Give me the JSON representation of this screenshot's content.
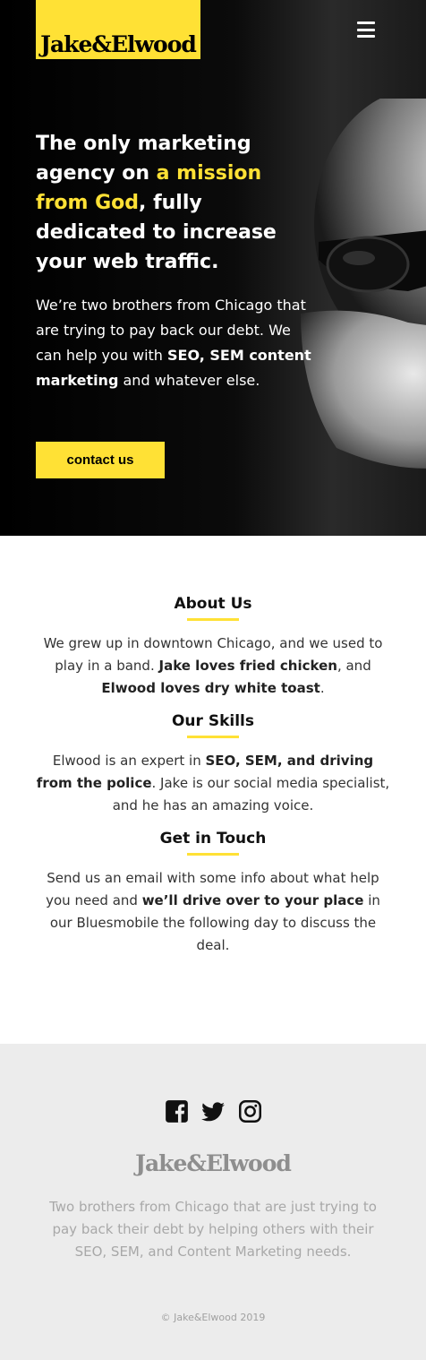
{
  "header": {
    "logo": "Jake&Elwood",
    "menu_icon": "hamburger-menu-icon"
  },
  "hero": {
    "title_part1": "The only marketing agency on ",
    "title_highlight": "a mission from God",
    "title_part2": ", fully dedicated to increase your web traffic.",
    "text_part1": "We’re two brothers from Chicago that are trying to pay back our debt. We can help you with ",
    "text_bold": "SEO, SEM content marketing",
    "text_part2": " and whatever else.",
    "cta_label": "contact us"
  },
  "sections": {
    "about": {
      "title": "About Us",
      "p1": "We grew up in downtown Chicago, and we used to play in a band. ",
      "b1": "Jake loves fried chicken",
      "p2": ", and ",
      "b2": "Elwood loves dry white toast",
      "p3": "."
    },
    "skills": {
      "title": "Our Skills",
      "p1": "Elwood is an expert in ",
      "b1": "SEO, SEM, and driving from the police",
      "p2": ". Jake is our social media specialist, and he has an amazing voice."
    },
    "contact": {
      "title": "Get in Touch",
      "p1": "Send us an email with some info about what help you need and ",
      "b1": "we’ll drive over to your place",
      "p2": " in our Bluesmobile the following day to discuss the deal."
    }
  },
  "footer": {
    "social_icons": [
      "facebook-icon",
      "twitter-icon",
      "instagram-icon"
    ],
    "logo": "Jake&Elwood",
    "text": "Two brothers from Chicago that are just trying to pay back their debt by helping others with their SEO, SEM, and Content Marketing needs.",
    "copyright": "© Jake&Elwood 2019"
  },
  "colors": {
    "accent": "#ffe135",
    "hero_bg": "#000000",
    "footer_bg": "#ececec"
  }
}
